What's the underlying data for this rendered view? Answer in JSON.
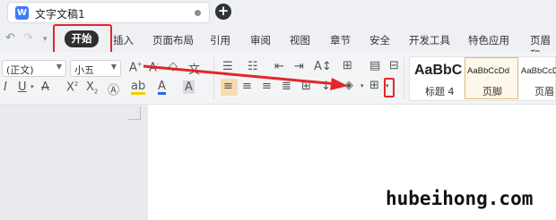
{
  "tab": {
    "title": "文字文稿1",
    "doc_icon": "W",
    "new_tab": "+"
  },
  "menu": {
    "home": "开始",
    "items": [
      "插入",
      "页面布局",
      "引用",
      "审阅",
      "视图",
      "章节",
      "安全",
      "开发工具",
      "特色应用",
      "页眉和"
    ]
  },
  "ribbon": {
    "font_name": "(正文)",
    "font_size": "小五",
    "styles": [
      {
        "sample": "AaBbC",
        "name": "标题 4"
      },
      {
        "sample": "AaBbCcDd",
        "name": "页脚"
      },
      {
        "sample": "AaBbCcD",
        "name": "页眉"
      }
    ]
  },
  "watermark": "hubeihong.com",
  "colors": {
    "highlight_red": "#e3262a",
    "accent_blue": "#3e7bf6",
    "active_tab": "#2f2f2f",
    "selected_style": "#e3b96a"
  }
}
